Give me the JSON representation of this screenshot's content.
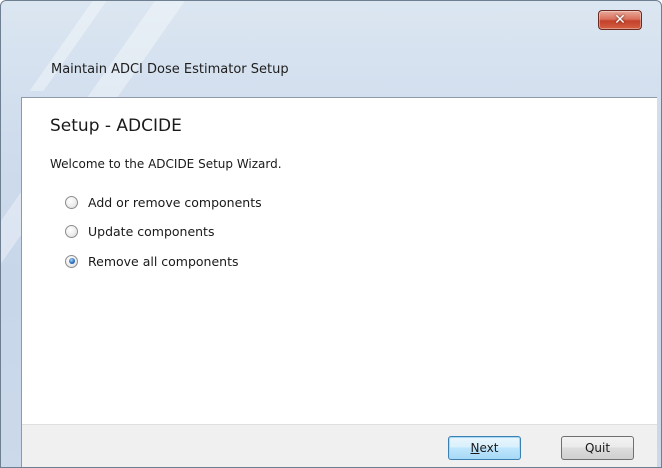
{
  "window": {
    "title": "Maintain ADCI Dose Estimator Setup",
    "close_icon": "close-icon"
  },
  "wizard": {
    "heading": "Setup - ADCIDE",
    "welcome": "Welcome to the ADCIDE Setup Wizard.",
    "options": [
      {
        "label": "Add or remove components",
        "selected": false
      },
      {
        "label": "Update components",
        "selected": false
      },
      {
        "label": "Remove all components",
        "selected": true
      }
    ]
  },
  "buttons": {
    "next_mnemonic": "N",
    "next_rest": "ext",
    "quit": "Quit"
  },
  "colors": {
    "accent": "#2a6fbf",
    "close_button": "#c3422b"
  }
}
